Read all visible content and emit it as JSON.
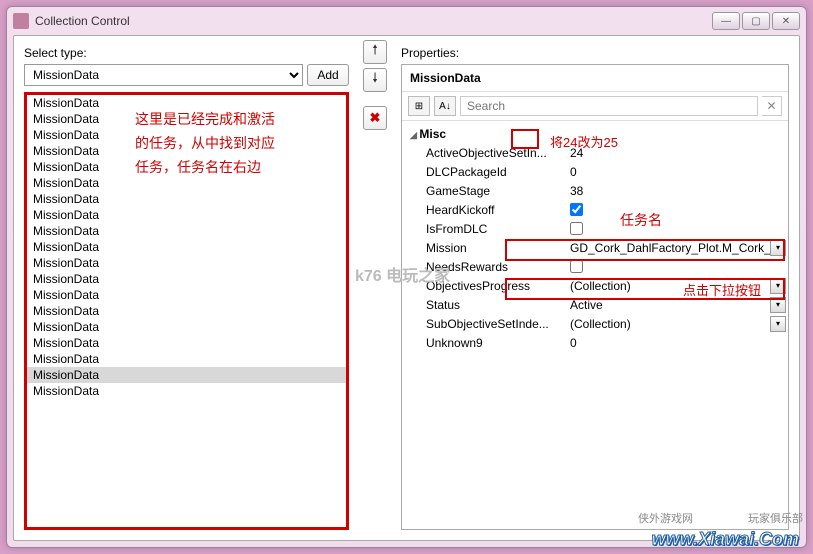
{
  "window": {
    "title": "Collection Control"
  },
  "left": {
    "label": "Select type:",
    "type_options": [
      "MissionData"
    ],
    "type_selected": "MissionData",
    "add_label": "Add",
    "items": [
      "MissionData",
      "MissionData",
      "MissionData",
      "MissionData",
      "MissionData",
      "MissionData",
      "MissionData",
      "MissionData",
      "MissionData",
      "MissionData",
      "MissionData",
      "MissionData",
      "MissionData",
      "MissionData",
      "MissionData",
      "MissionData",
      "MissionData",
      "MissionData",
      "MissionData"
    ],
    "selected_index": 17,
    "annotation": "这里是已经完成和激活的任务，从中找到对应任务，任务名在右边"
  },
  "right": {
    "label": "Properties:",
    "header": "MissionData",
    "search_placeholder": "Search",
    "category": "Misc",
    "props": {
      "ActiveObjectiveSetIn": {
        "label": "ActiveObjectiveSetIn...",
        "value": "24"
      },
      "DLCPackageId": {
        "label": "DLCPackageId",
        "value": "0"
      },
      "GameStage": {
        "label": "GameStage",
        "value": "38"
      },
      "HeardKickoff": {
        "label": "HeardKickoff",
        "checked": true
      },
      "IsFromDLC": {
        "label": "IsFromDLC",
        "checked": false
      },
      "Mission": {
        "label": "Mission",
        "value": "GD_Cork_DahlFactory_Plot.M_Cork_DahlFactory_"
      },
      "NeedsRewards": {
        "label": "NeedsRewards",
        "checked": false
      },
      "ObjectivesProgress": {
        "label": "ObjectivesProgress",
        "value": "(Collection)"
      },
      "Status": {
        "label": "Status",
        "value": "Active"
      },
      "SubObjectiveSetInde": {
        "label": "SubObjectiveSetInde...",
        "value": "(Collection)"
      },
      "Unknown9": {
        "label": "Unknown9",
        "value": "0"
      }
    }
  },
  "annotations": {
    "change24": "将24改为25",
    "taskname": "任务名",
    "clickdrop": "点击下拉按钮"
  },
  "watermark": {
    "left": "侠外游戏网",
    "right": "玩家俱乐部",
    "url": "www.Xiawai.Com",
    "game": "k76 电玩之家"
  }
}
